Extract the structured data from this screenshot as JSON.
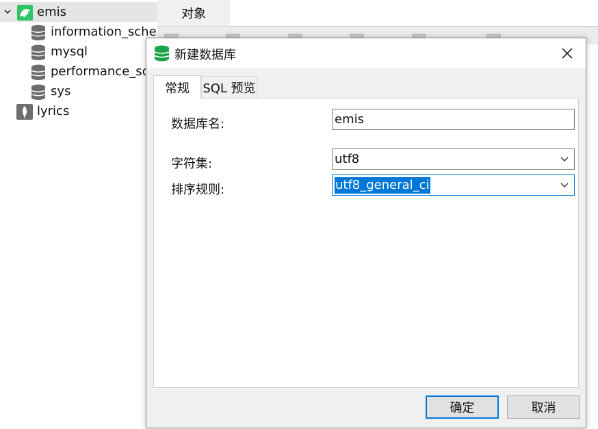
{
  "tree": {
    "connection": {
      "label": "emis",
      "expanded": true,
      "icon": "mysql-dolphin-icon"
    },
    "databases": [
      {
        "label": "information_schema",
        "icon": "database-icon"
      },
      {
        "label": "mysql",
        "icon": "database-icon"
      },
      {
        "label": "performance_schema",
        "icon": "database-icon"
      },
      {
        "label": "sys",
        "icon": "database-icon"
      }
    ],
    "other_connection": {
      "label": "lyrics",
      "icon": "mongodb-leaf-icon"
    }
  },
  "main": {
    "objects_tab_label": "对象"
  },
  "dialog": {
    "title": "新建数据库",
    "tabs": [
      {
        "label": "常规",
        "active": true
      },
      {
        "label": "SQL 预览",
        "active": false
      }
    ],
    "fields": {
      "db_name": {
        "label": "数据库名:",
        "value": "emis"
      },
      "charset": {
        "label": "字符集:",
        "value": "utf8"
      },
      "collation": {
        "label": "排序规则:",
        "value": "utf8_general_ci"
      }
    },
    "buttons": {
      "ok": "确定",
      "cancel": "取消"
    }
  },
  "colors": {
    "accent": "#0078d7",
    "connection_icon": "#2fc36a",
    "db_icon": "#6d6d6d",
    "title_icon": "#1fa34a"
  }
}
